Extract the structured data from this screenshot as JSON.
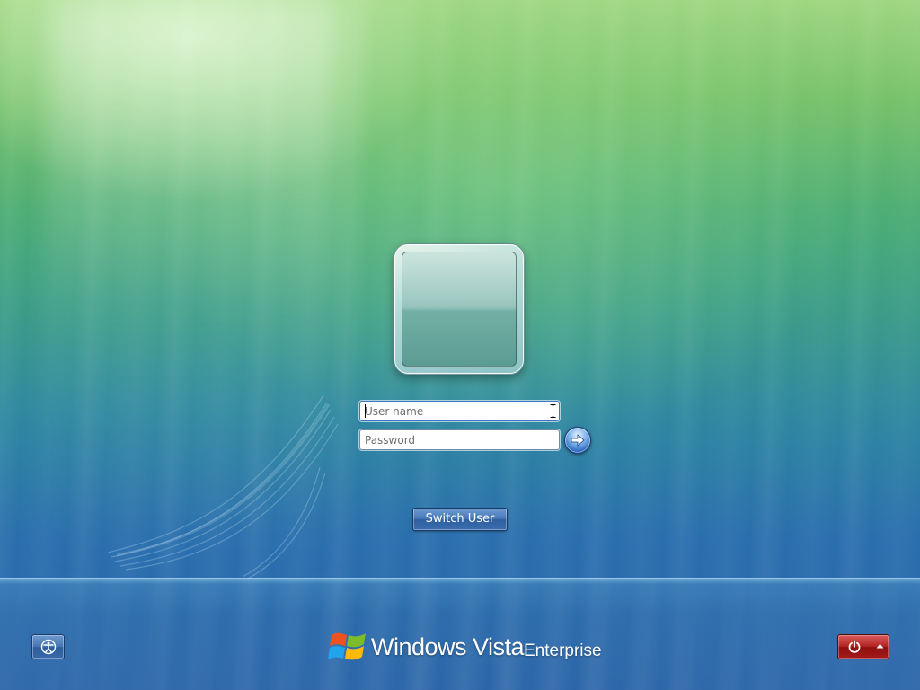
{
  "login": {
    "username_placeholder": "User name",
    "password_placeholder": "Password",
    "username_value": "",
    "password_value": "",
    "submit_icon": "arrow-right-icon"
  },
  "switch_user_label": "Switch User",
  "ease_of_access_icon": "ease-of-access-icon",
  "brand": {
    "logo_icon": "windows-flag-icon",
    "product": "Windows Vista",
    "trademark": "™",
    "edition": "Enterprise"
  },
  "shutdown": {
    "power_icon": "power-icon",
    "options_icon": "chevron-up-icon"
  },
  "colors": {
    "shutdown_red": "#b42424",
    "button_blue": "#4577b6",
    "field_focus_border": "#3d78c8"
  }
}
